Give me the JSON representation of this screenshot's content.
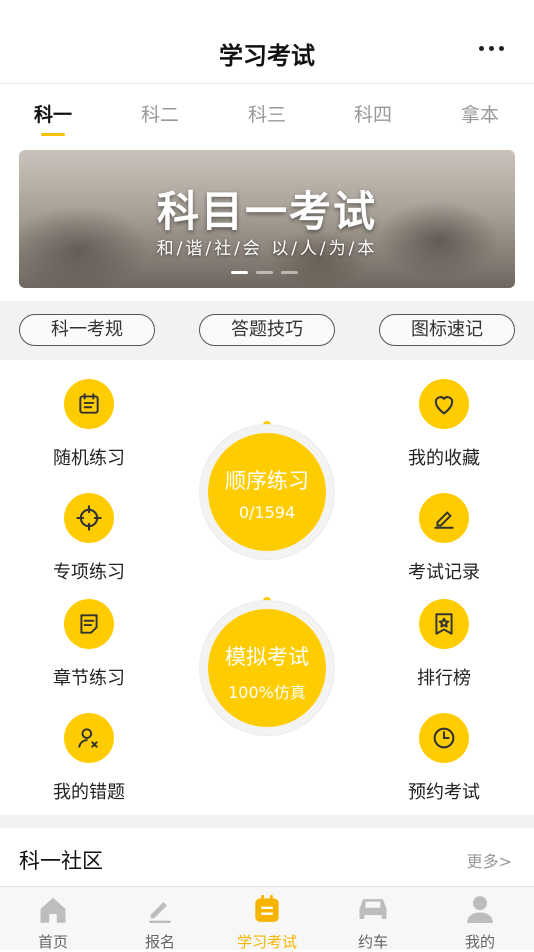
{
  "header": {
    "title": "学习考试",
    "more_icon": "more-dots-icon"
  },
  "tabs": [
    {
      "label": "科一",
      "active": true
    },
    {
      "label": "科二",
      "active": false
    },
    {
      "label": "科三",
      "active": false
    },
    {
      "label": "科四",
      "active": false
    },
    {
      "label": "拿本",
      "active": false
    }
  ],
  "banner": {
    "title": "科目一考试",
    "subtitle": "和/谐/社/会 以/人/为/本",
    "slide_index": 1,
    "slide_count": 3
  },
  "quick_links": [
    "科一考规",
    "答题技巧",
    "图标速记"
  ],
  "practice_left": [
    {
      "label": "随机练习",
      "icon": "calendar-check-icon"
    },
    {
      "label": "专项练习",
      "icon": "crosshair-icon"
    },
    {
      "label": "章节练习",
      "icon": "document-icon"
    },
    {
      "label": "我的错题",
      "icon": "user-x-icon"
    }
  ],
  "practice_right": [
    {
      "label": "我的收藏",
      "icon": "heart-icon"
    },
    {
      "label": "考试记录",
      "icon": "edit-icon"
    },
    {
      "label": "排行榜",
      "icon": "ranking-badge-icon"
    },
    {
      "label": "预约考试",
      "icon": "clock-icon"
    }
  ],
  "sequence": {
    "label": "顺序练习",
    "progress": "0/1594"
  },
  "mock_exam": {
    "label": "模拟考试",
    "subtitle": "100%仿真"
  },
  "community": {
    "title": "科一社区",
    "more": "更多>"
  },
  "bottom_nav": [
    {
      "label": "首页",
      "icon": "home-icon",
      "active": false
    },
    {
      "label": "报名",
      "icon": "pencil-icon",
      "active": false
    },
    {
      "label": "学习考试",
      "icon": "study-icon",
      "active": true
    },
    {
      "label": "约车",
      "icon": "car-icon",
      "active": false
    },
    {
      "label": "我的",
      "icon": "person-icon",
      "active": false
    }
  ],
  "colors": {
    "accent": "#ffcc00",
    "active_text": "#f5b400"
  }
}
